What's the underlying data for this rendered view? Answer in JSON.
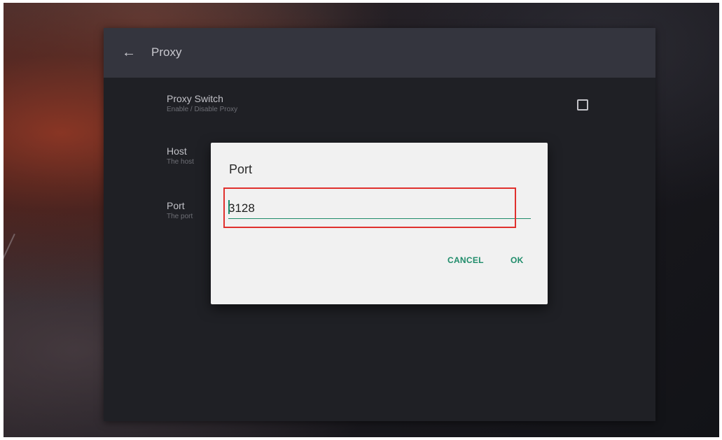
{
  "app_bar": {
    "back_icon": "arrow-left-icon",
    "title": "Proxy"
  },
  "preferences": [
    {
      "title": "Proxy Switch",
      "summary": "Enable / Disable Proxy"
    },
    {
      "title": "Host",
      "summary": "The host"
    },
    {
      "title": "Port",
      "summary": "The port"
    }
  ],
  "proxy_switch_checked": false,
  "dialog": {
    "title": "Port",
    "input_value": "3128",
    "cancel_label": "CANCEL",
    "ok_label": "OK"
  },
  "colors": {
    "accent": "#1f8c6a",
    "highlight": "#e0302d",
    "app_bar": "#34353e",
    "panel": "#1f2025",
    "dialog_bg": "#f1f1f1"
  }
}
